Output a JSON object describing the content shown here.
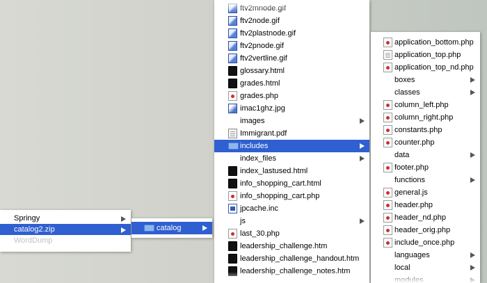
{
  "menu1": {
    "items": [
      {
        "label": "Springy",
        "submenu": true
      },
      {
        "label": "catalog2.zip",
        "submenu": true,
        "selected": true
      },
      {
        "label": "WordDump"
      }
    ]
  },
  "menu2": {
    "items": [
      {
        "label": "catalog",
        "icon": "folder-icon",
        "submenu": true,
        "selected": true
      }
    ]
  },
  "menu3": {
    "items": [
      {
        "label": "ftv2mnode.gif",
        "icon": "gif-file-icon"
      },
      {
        "label": "ftv2node.gif",
        "icon": "gif-file-icon"
      },
      {
        "label": "ftv2plastnode.gif",
        "icon": "gif-file-icon"
      },
      {
        "label": "ftv2pnode.gif",
        "icon": "gif-file-icon"
      },
      {
        "label": "ftv2vertline.gif",
        "icon": "gif-file-icon"
      },
      {
        "label": "glossary.html",
        "icon": "html-file-icon"
      },
      {
        "label": "grades.html",
        "icon": "html-file-icon"
      },
      {
        "label": "grades.php",
        "icon": "php-file-icon"
      },
      {
        "label": "imac1ghz.jpg",
        "icon": "jpg-file-icon"
      },
      {
        "label": "images",
        "icon": "",
        "submenu": true
      },
      {
        "label": "Immigrant.pdf",
        "icon": "pdf-file-icon"
      },
      {
        "label": "includes",
        "icon": "folder-icon",
        "submenu": true,
        "selected": true
      },
      {
        "label": "index_files",
        "icon": "",
        "submenu": true
      },
      {
        "label": "index_lastused.html",
        "icon": "html-file-icon"
      },
      {
        "label": "info_shopping_cart.html",
        "icon": "html-file-icon"
      },
      {
        "label": "info_shopping_cart.php",
        "icon": "php-file-icon"
      },
      {
        "label": "jpcache.inc",
        "icon": "inc-file-icon"
      },
      {
        "label": "js",
        "icon": "",
        "submenu": true
      },
      {
        "label": "last_30.php",
        "icon": "php-file-icon"
      },
      {
        "label": "leadership_challenge.htm",
        "icon": "html-file-icon"
      },
      {
        "label": "leadership_challenge_handout.htm",
        "icon": "html-file-icon"
      },
      {
        "label": "leadership_challenge_notes.htm",
        "icon": "html-file-icon"
      }
    ]
  },
  "menu4": {
    "items": [
      {
        "label": "application_bottom.php",
        "icon": "php-file-icon"
      },
      {
        "label": "application_top.php",
        "icon": "text-file-icon"
      },
      {
        "label": "application_top_nd.php",
        "icon": "php-file-icon"
      },
      {
        "label": "boxes",
        "icon": "",
        "submenu": true
      },
      {
        "label": "classes",
        "icon": "",
        "submenu": true
      },
      {
        "label": "column_left.php",
        "icon": "php-file-icon"
      },
      {
        "label": "column_right.php",
        "icon": "php-file-icon"
      },
      {
        "label": "constants.php",
        "icon": "php-file-icon"
      },
      {
        "label": "counter.php",
        "icon": "php-file-icon"
      },
      {
        "label": "data",
        "icon": "",
        "submenu": true
      },
      {
        "label": "footer.php",
        "icon": "php-file-icon"
      },
      {
        "label": "functions",
        "icon": "",
        "submenu": true
      },
      {
        "label": "general.js",
        "icon": "php-file-icon"
      },
      {
        "label": "header.php",
        "icon": "php-file-icon"
      },
      {
        "label": "header_nd.php",
        "icon": "php-file-icon"
      },
      {
        "label": "header_orig.php",
        "icon": "php-file-icon"
      },
      {
        "label": "include_once.php",
        "icon": "php-file-icon"
      },
      {
        "label": "languages",
        "icon": "",
        "submenu": true
      },
      {
        "label": "local",
        "icon": "",
        "submenu": true
      },
      {
        "label": "modules",
        "icon": "",
        "submenu": true
      }
    ]
  },
  "colors": {
    "selection": "#2f5fd0",
    "menu_bg": "#ffffff",
    "desktop": "#d4d6cf"
  }
}
